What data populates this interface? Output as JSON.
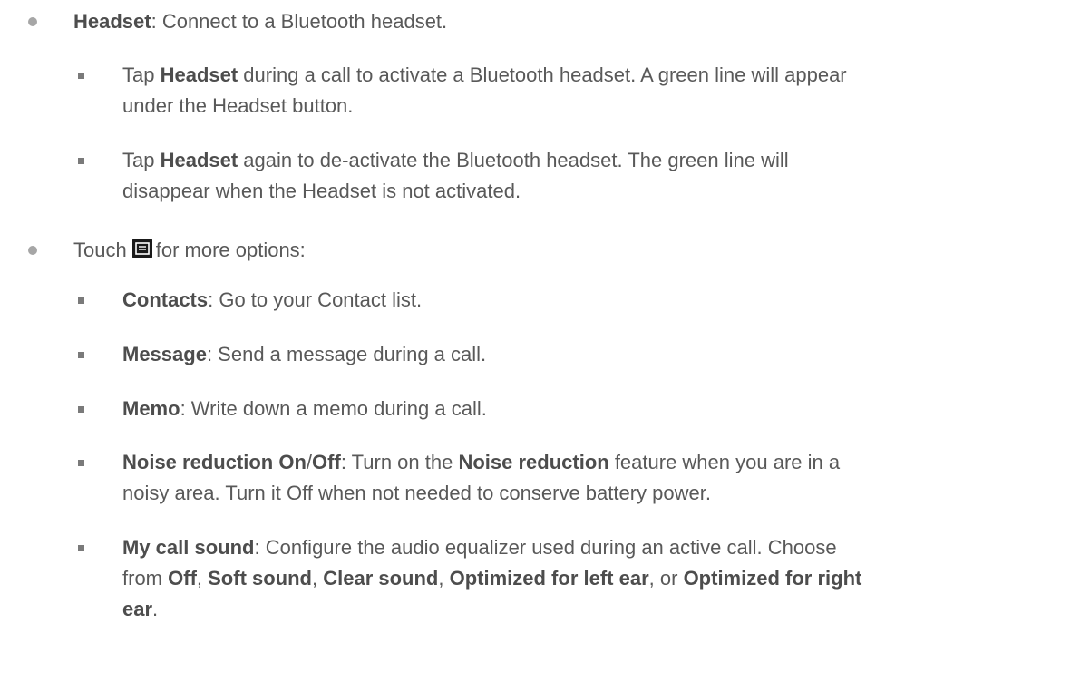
{
  "headset": {
    "term": "Headset",
    "desc": ": Connect to a Bluetooth headset.",
    "sub1": {
      "pre": "Tap ",
      "term": "Headset",
      "line1": " during a call to activate a Bluetooth headset. A green line will appear",
      "line2": "under the Headset button."
    },
    "sub2": {
      "pre": "Tap ",
      "term": "Headset",
      "line1": " again to de-activate the Bluetooth headset. The green line will",
      "line2": "disappear when the Headset is not activated."
    }
  },
  "touch": {
    "pre": "Touch",
    "icon": "menu-icon",
    "post": "for more options:"
  },
  "contacts": {
    "term": "Contacts",
    "desc": ": Go to your Contact list."
  },
  "message": {
    "term": "Message",
    "desc": ": Send a message during a call."
  },
  "memo": {
    "term": "Memo",
    "desc": ": Write down a memo during a call."
  },
  "noise": {
    "term_a": "Noise reduction On",
    "slash": "/",
    "term_b": "Off",
    "mid": ": Turn on the ",
    "term_c": "Noise reduction",
    "line1_end": " feature when you are in a",
    "line2": "noisy area. Turn it Off when not needed to conserve battery power."
  },
  "callsound": {
    "term": "My call sound",
    "line1": ": Configure the audio equalizer used during an active call. Choose",
    "from": "from ",
    "opt1": "Off",
    "sep1": ", ",
    "opt2": "Soft sound",
    "sep2": ", ",
    "opt3": "Clear sound",
    "sep3": ", ",
    "opt4": "Optimized for left ear",
    "sep4": ", or ",
    "opt5": "Optimized for right",
    "opt5_end": "ear",
    "end": "."
  }
}
